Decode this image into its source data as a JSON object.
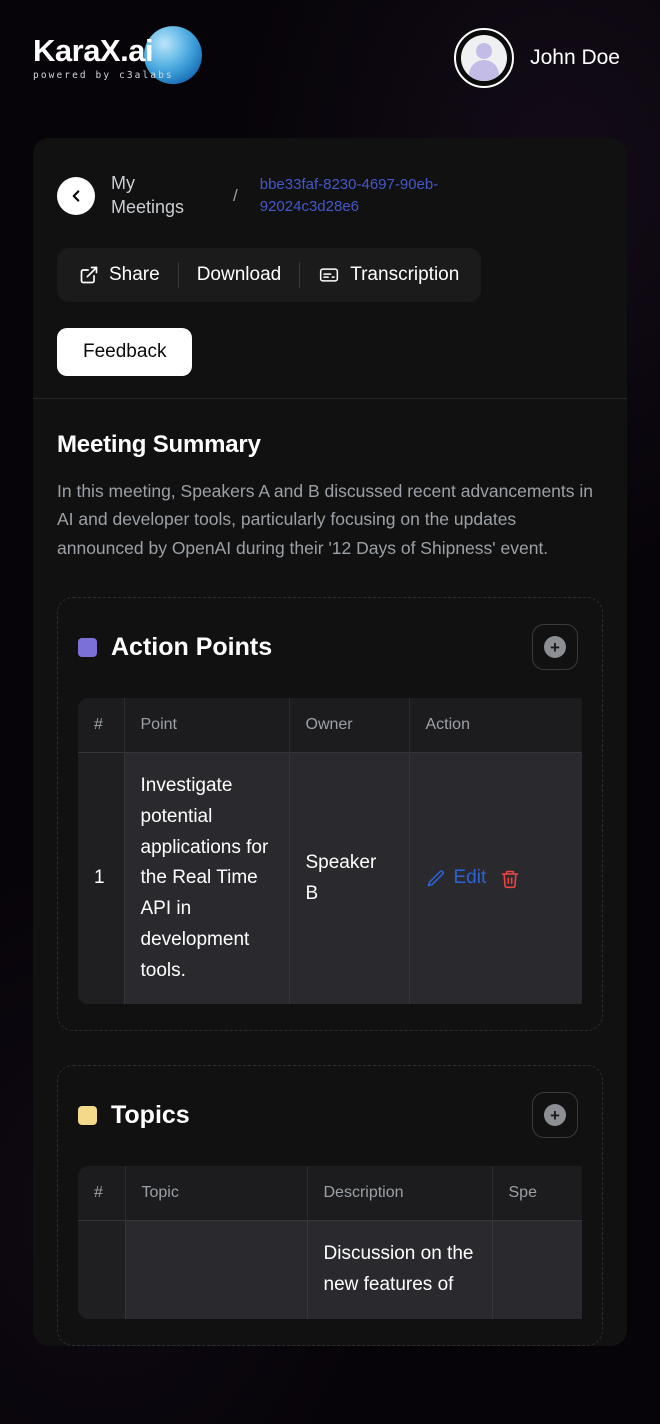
{
  "brand": {
    "name": "KaraX.ai",
    "name_main": "KaraX",
    "name_suffix": ".ai",
    "tagline": "powered by c3alabs",
    "accent_blue": "#3a9bd6"
  },
  "header": {
    "user_name": "John Doe",
    "avatar_icon": "user-avatar-icon"
  },
  "breadcrumb": {
    "back_icon": "chevron-left-icon",
    "parent": "My Meetings",
    "separator": "/",
    "current_id": "bbe33faf-8230-4697-90eb-92024c3d28e6",
    "link_color": "#4657c9"
  },
  "toolbar": {
    "share_label": "Share",
    "share_icon": "external-link-icon",
    "download_label": "Download",
    "transcription_label": "Transcription",
    "transcription_icon": "caption-box-icon",
    "feedback_label": "Feedback"
  },
  "summary": {
    "title": "Meeting Summary",
    "body": "In this meeting, Speakers A and B discussed recent advancements in AI and developer tools, particularly focusing on the updates announced by OpenAI during their '12 Days of Shipness' event."
  },
  "action_points": {
    "title": "Action Points",
    "swatch_color": "#7b70d8",
    "add_icon": "plus-icon",
    "columns": [
      "#",
      "Point",
      "Owner",
      "Action"
    ],
    "rows": [
      {
        "index": "1",
        "point": "Investigate potential applications for the Real Time API in development tools.",
        "owner": "Speaker B",
        "edit_label": "Edit",
        "edit_icon": "pencil-icon",
        "delete_icon": "trash-icon",
        "edit_color": "#2b63d9",
        "delete_color": "#ef4444"
      }
    ]
  },
  "topics": {
    "title": "Topics",
    "swatch_color": "#f5d98b",
    "add_icon": "plus-icon",
    "columns": [
      "#",
      "Topic",
      "Description",
      "Spe"
    ],
    "rows": [
      {
        "index": "",
        "topic": "",
        "description": "Discussion on the new features of",
        "speaker": ""
      }
    ]
  }
}
